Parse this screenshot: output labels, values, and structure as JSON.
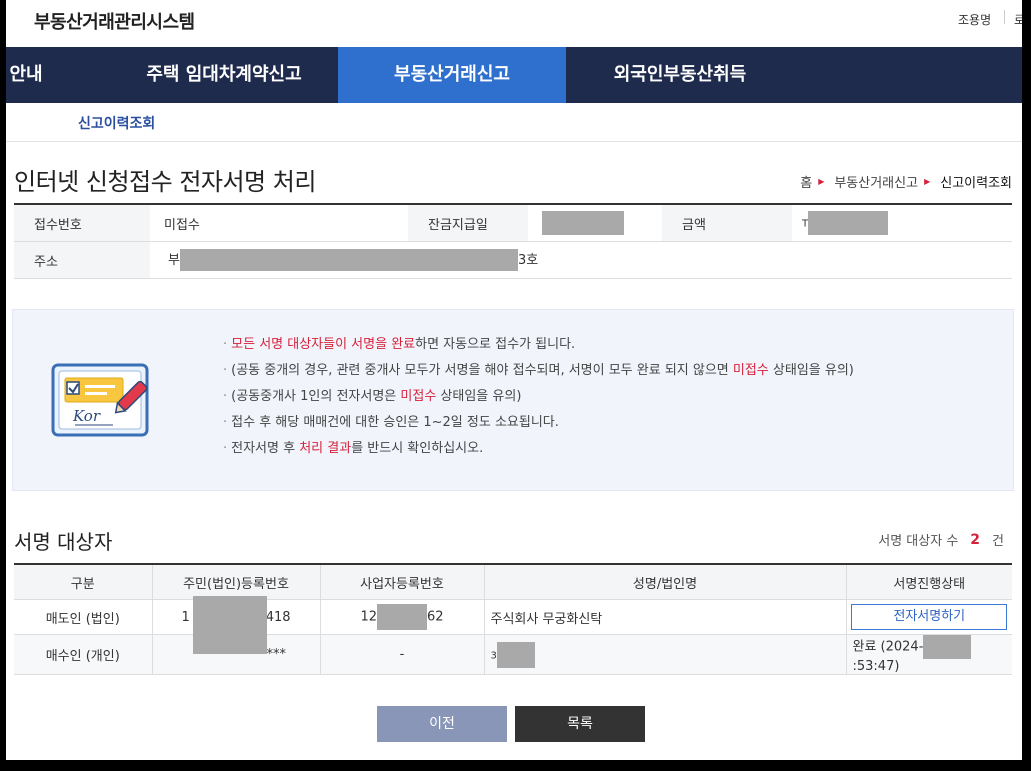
{
  "header": {
    "site_title": "부동산거래관리시스템",
    "user_name": "조용명",
    "user_extra": "로"
  },
  "nav": {
    "items": [
      {
        "label": "안내"
      },
      {
        "label": "주택 임대차계약신고"
      },
      {
        "label": "부동산거래신고"
      },
      {
        "label": "외국인부동산취득"
      }
    ],
    "active_index": 2
  },
  "subnav": {
    "item": "신고이력조회"
  },
  "page": {
    "title": "인터넷 신청접수 전자서명 처리",
    "breadcrumb": [
      "홈",
      "부동산거래신고",
      "신고이력조회"
    ]
  },
  "info": {
    "receipt_label": "접수번호",
    "receipt_value": "미접수",
    "balance_label": "잔금지급일",
    "amount_label": "금액",
    "amount_prefix": "T",
    "address_label": "주소",
    "address_prefix": "부",
    "address_suffix": "3호"
  },
  "notice": {
    "items": [
      {
        "parts": [
          {
            "text": "모든 서명 대상자들이 서명을 완료",
            "red": true
          },
          {
            "text": "하면 자동으로 접수가 됩니다.",
            "red": false
          }
        ]
      },
      {
        "parts": [
          {
            "text": "(공동 중개의 경우, 관련 중개사 모두가 서명을 해야 접수되며, 서명이 모두 완료 되지 않으면 ",
            "red": false
          },
          {
            "text": "미접수",
            "red": true
          },
          {
            "text": " 상태임을 유의)",
            "red": false
          }
        ]
      },
      {
        "parts": [
          {
            "text": "(공동중개사 1인의 전자서명은 ",
            "red": false
          },
          {
            "text": "미접수",
            "red": true
          },
          {
            "text": " 상태임을 유의)",
            "red": false
          }
        ]
      },
      {
        "parts": [
          {
            "text": "접수 후 해당 매매건에 대한 승인은 1~2일 정도 소요됩니다.",
            "red": false
          }
        ]
      },
      {
        "parts": [
          {
            "text": "전자서명 후 ",
            "red": false
          },
          {
            "text": "처리 결과",
            "red": true
          },
          {
            "text": "를 반드시 확인하십시오.",
            "red": false
          }
        ]
      }
    ],
    "card_text": "Kor"
  },
  "signers": {
    "title": "서명 대상자",
    "count_label": "서명 대상자 수",
    "count": "2",
    "count_unit": "건",
    "columns": [
      "구분",
      "주민(법인)등록번호",
      "사업자등록번호",
      "성명/법인명",
      "서명진행상태"
    ],
    "rows": [
      {
        "type": "매도인 (법인)",
        "reg_prefix": "1",
        "reg_suffix": "418",
        "biz_prefix": "12",
        "biz_suffix": "62",
        "name": "주식회사 무궁화신탁",
        "status": "전자서명하기"
      },
      {
        "type": "매수인 (개인)",
        "reg_prefix": "",
        "reg_suffix": "***",
        "biz": "-",
        "name_prefix": "3",
        "status_prefix": "완료 (2024-",
        "status_suffix": ":53:47)"
      }
    ]
  },
  "buttons": {
    "prev": "이전",
    "list": "목록"
  },
  "colors": {
    "nav_bg": "#1f2b4d",
    "nav_active": "#2f6fce",
    "accent_red": "#d6213b",
    "btn_prev": "#8a96b8",
    "btn_list": "#333333"
  }
}
